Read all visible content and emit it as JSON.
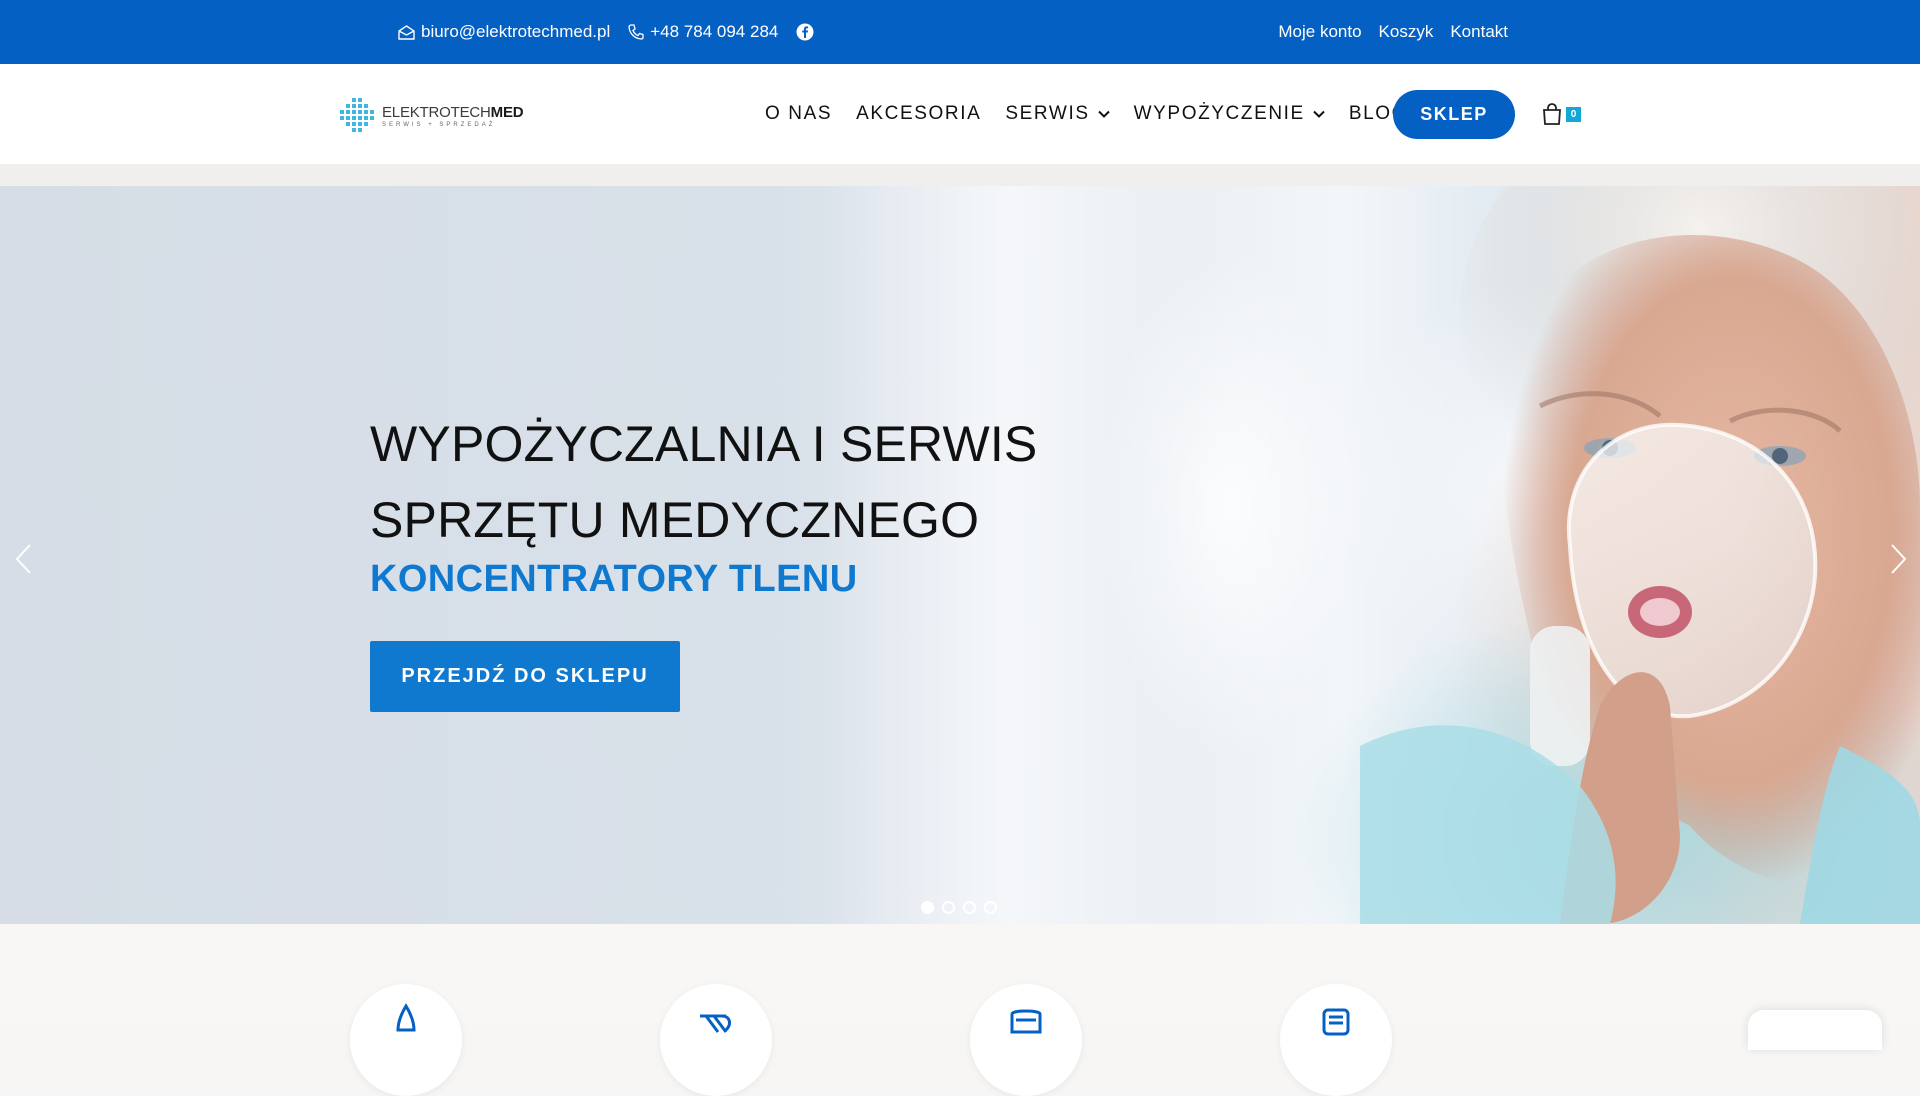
{
  "topbar": {
    "email": "biuro@elektrotechmed.pl",
    "phone": "+48 784 094 284",
    "email_icon": "envelope-icon",
    "phone_icon": "phone-icon",
    "social_icon": "facebook-icon",
    "links": [
      "Moje konto",
      "Koszyk",
      "Kontakt"
    ]
  },
  "header": {
    "logo_brand_main": "ELEKTROTECH",
    "logo_brand_bold": "MED",
    "logo_sub": "SERWIS + SPRZEDAŻ",
    "nav": [
      {
        "label": "O NAS",
        "has_dropdown": false
      },
      {
        "label": "AKCESORIA",
        "has_dropdown": false
      },
      {
        "label": "SERWIS",
        "has_dropdown": true
      },
      {
        "label": "WYPOŻYCZENIE",
        "has_dropdown": true
      },
      {
        "label": "BLOG",
        "has_dropdown": false
      }
    ],
    "shop_button": "SKLEP",
    "cart_count": "0",
    "cart_icon": "shopping-bag-icon"
  },
  "hero": {
    "title_line1": "WYPOŻYCZALNIA I SERWIS",
    "title_line2": "SPRZĘTU MEDYCZNEGO",
    "subtitle": "KONCENTRATORY TLENU",
    "cta": "PRZEJDŹ DO SKLEPU",
    "slides": 4,
    "active_slide": 1
  },
  "colors": {
    "brand_blue": "#0560c4",
    "accent_blue": "#0f78cf",
    "badge": "#12a7d6"
  }
}
